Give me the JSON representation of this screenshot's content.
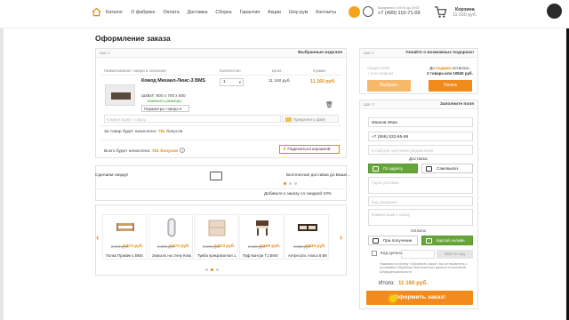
{
  "header": {
    "nav": [
      "Каталог",
      "О фабрике",
      "Оплата",
      "Доставка",
      "Сборка",
      "Гарантия",
      "Акции",
      "Шоу-рум",
      "Контакты"
    ],
    "hours": "Ежедневно с 09:00 до 20:00",
    "phone": "+7 (499) 110-71-09",
    "cart_label": "Корзина",
    "cart_sum": "11 160 руб."
  },
  "page_title": "Оформление заказа",
  "order": {
    "step": "Шаг 1",
    "head": "Выбранные изделия",
    "columns": [
      "Наименование товара и описание",
      "Количество",
      "Цена",
      "Сумма"
    ],
    "product_name": "Комод Михаил-Люкс-3 BMS",
    "qty": "1",
    "price": "11 160 руб.",
    "sum": "11 160 руб.",
    "size": "ШхВхГ: 800 х 700 х 500",
    "change_size": "изменить размеры",
    "params": "Параметры товара",
    "comment_ph": "Комментарий к товару...",
    "attach": "Прикрепить файл",
    "bonus_prefix": "За товар будет начислено:",
    "bonus_value": "781",
    "bonus_suffix": "бонусов",
    "total_bonus_prefix": "Всего будет начислено:",
    "total_bonus_value": "781 бонусов",
    "share": "Поделиться корзиной"
  },
  "promo": {
    "left": "Сделаем скидку!",
    "right": "Бесплатная доставка до Ваше...",
    "addon_head": "Добавьте к заказу со скидкой 10%"
  },
  "addons": [
    {
      "old": "2 673 руб.",
      "new": "2 673 руб.",
      "name": "Полка Пракtик-1 BMS"
    },
    {
      "old": "2 673 руб.",
      "new": "2 673 руб.",
      "name": "Зеркало на стену Комфо-3 BMS"
    },
    {
      "old": "2 673 руб.",
      "new": "2 673 руб.",
      "name": "Тумба прикроватная 1.021 Люкс BMS"
    },
    {
      "old": "3 159 руб.",
      "new": "3 159 руб.",
      "name": "Пуф Кантри Т1 BMS"
    },
    {
      "old": "4 833 руб.",
      "new": "4 833 руб.",
      "name": "Антресоль Алиса 8 BMS"
    }
  ],
  "deals": {
    "step": "Шаг 2",
    "head": "Узнайте о возможных подарках!",
    "left_line1": "Скидка 500р",
    "left_line2": "+ 2-м товарам",
    "left_btn": "Выбрать",
    "right_line1_a": "До",
    "right_line1_b": "подарка",
    "right_line1_c": "осталось:",
    "right_line2": "2 товара или 10840 руб.",
    "right_btn": "Узнать"
  },
  "form": {
    "step": "Шаг 3",
    "head": "Заполните поля",
    "name": "Иванов Иван",
    "phone": "+7 (956) 532-65-98",
    "email_ph": "E-mail для получения уведомлений",
    "delivery_label": "Доставка",
    "by_address": "По адресу",
    "pickup": "Самовывоз",
    "address_ph": "Адрес доставки",
    "intercom_ph": "Код домофона",
    "comment_ph": "Комментарий к заказу",
    "payment_label": "Оплата:",
    "on_receive": "При получении",
    "card_online": "Картой онлайн",
    "coupon_label": "Код купона",
    "coupon_btn": "Ввести код",
    "legal": "Нажимая на кнопку «Оформить заказ», вы соглашаетесь с условиями Обработки персональных данных и политикой конфиденциальности",
    "total_label": "Итого:",
    "total_value": "11 160 руб.",
    "checkout": "Оформить заказ!"
  },
  "colors": {
    "accent": "#e38a0f",
    "green": "#66a53a",
    "button": "#f28a1c"
  }
}
